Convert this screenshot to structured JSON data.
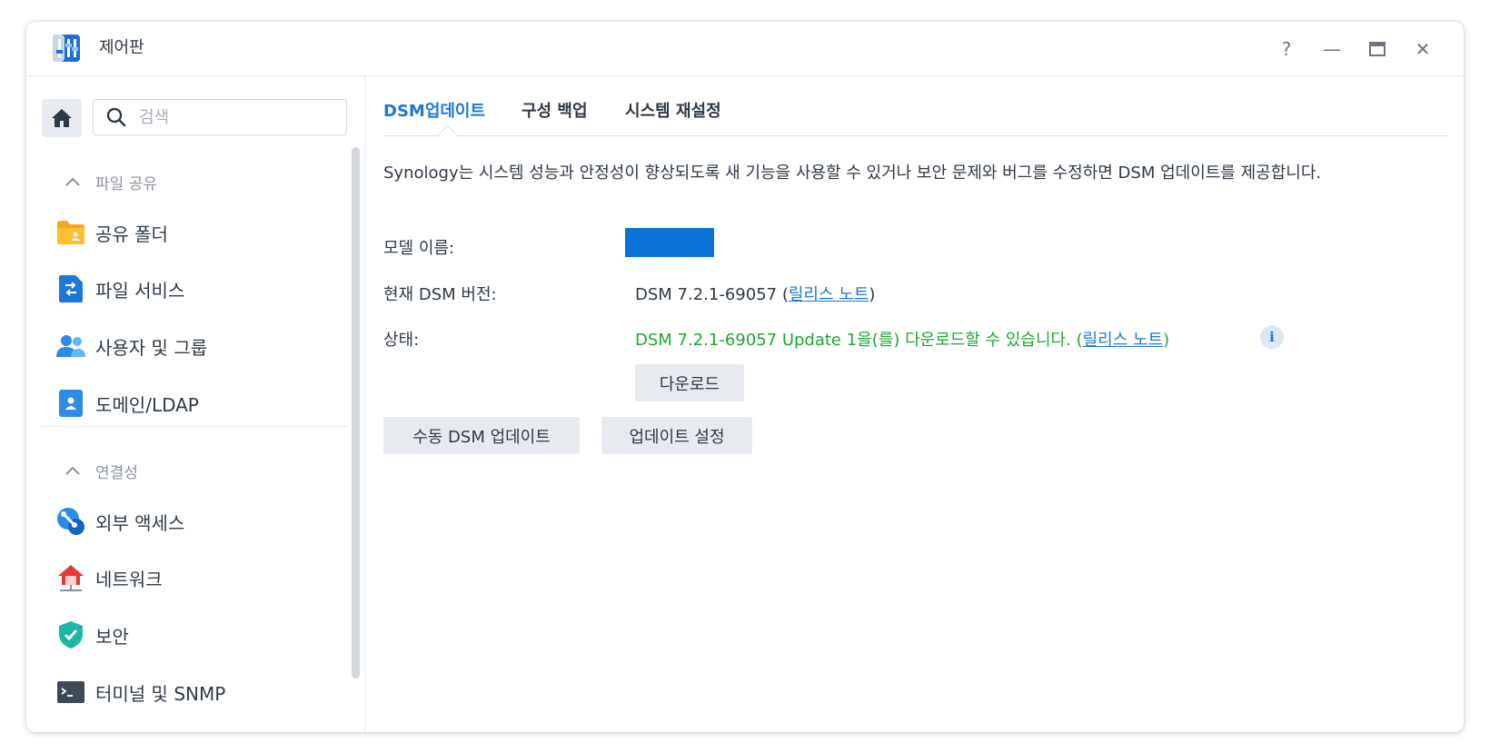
{
  "window": {
    "title": "제어판",
    "controls": {
      "help": "?",
      "minimize": "—",
      "maximize": "▭",
      "close": "✕"
    }
  },
  "sidebar": {
    "search_placeholder": "검색",
    "sections": [
      {
        "label": "파일 공유",
        "items": [
          {
            "label": "공유 폴더",
            "icon": "shared-folder-icon"
          },
          {
            "label": "파일 서비스",
            "icon": "file-services-icon"
          },
          {
            "label": "사용자 및 그룹",
            "icon": "users-groups-icon"
          },
          {
            "label": "도메인/LDAP",
            "icon": "domain-ldap-icon"
          }
        ]
      },
      {
        "label": "연결성",
        "items": [
          {
            "label": "외부 액세스",
            "icon": "external-access-icon"
          },
          {
            "label": "네트워크",
            "icon": "network-icon"
          },
          {
            "label": "보안",
            "icon": "security-shield-icon"
          },
          {
            "label": "터미널 및 SNMP",
            "icon": "terminal-icon"
          }
        ]
      }
    ]
  },
  "main": {
    "tabs": [
      {
        "label": "DSM업데이트",
        "active": true
      },
      {
        "label": "구성 백업",
        "active": false
      },
      {
        "label": "시스템 재설정",
        "active": false
      }
    ],
    "description": "Synology는 시스템 성능과 안정성이 향상되도록 새 기능을 사용할 수 있거나 보안 문제와 버그를 수정하면 DSM 업데이트를 제공합니다.",
    "model": {
      "label": "모델 이름:"
    },
    "current_version": {
      "label": "현재 DSM 버전:",
      "value": "DSM 7.2.1-69057",
      "link": "릴리스 노트",
      "open_paren": "(",
      "close_paren": ")"
    },
    "status": {
      "label": "상태:",
      "value": "DSM 7.2.1-69057 Update 1을(를) 다운로드할 수 있습니다.",
      "link": "릴리스 노트",
      "open_paren": "(",
      "close_paren": ")",
      "info": "i"
    },
    "buttons": {
      "download": "다운로드",
      "manual_update": "수동 DSM 업데이트",
      "update_settings": "업데이트 설정"
    }
  },
  "colors": {
    "accent": "#1e78d7",
    "status_green": "#20a633",
    "redaction_block": "#0a73d8"
  }
}
